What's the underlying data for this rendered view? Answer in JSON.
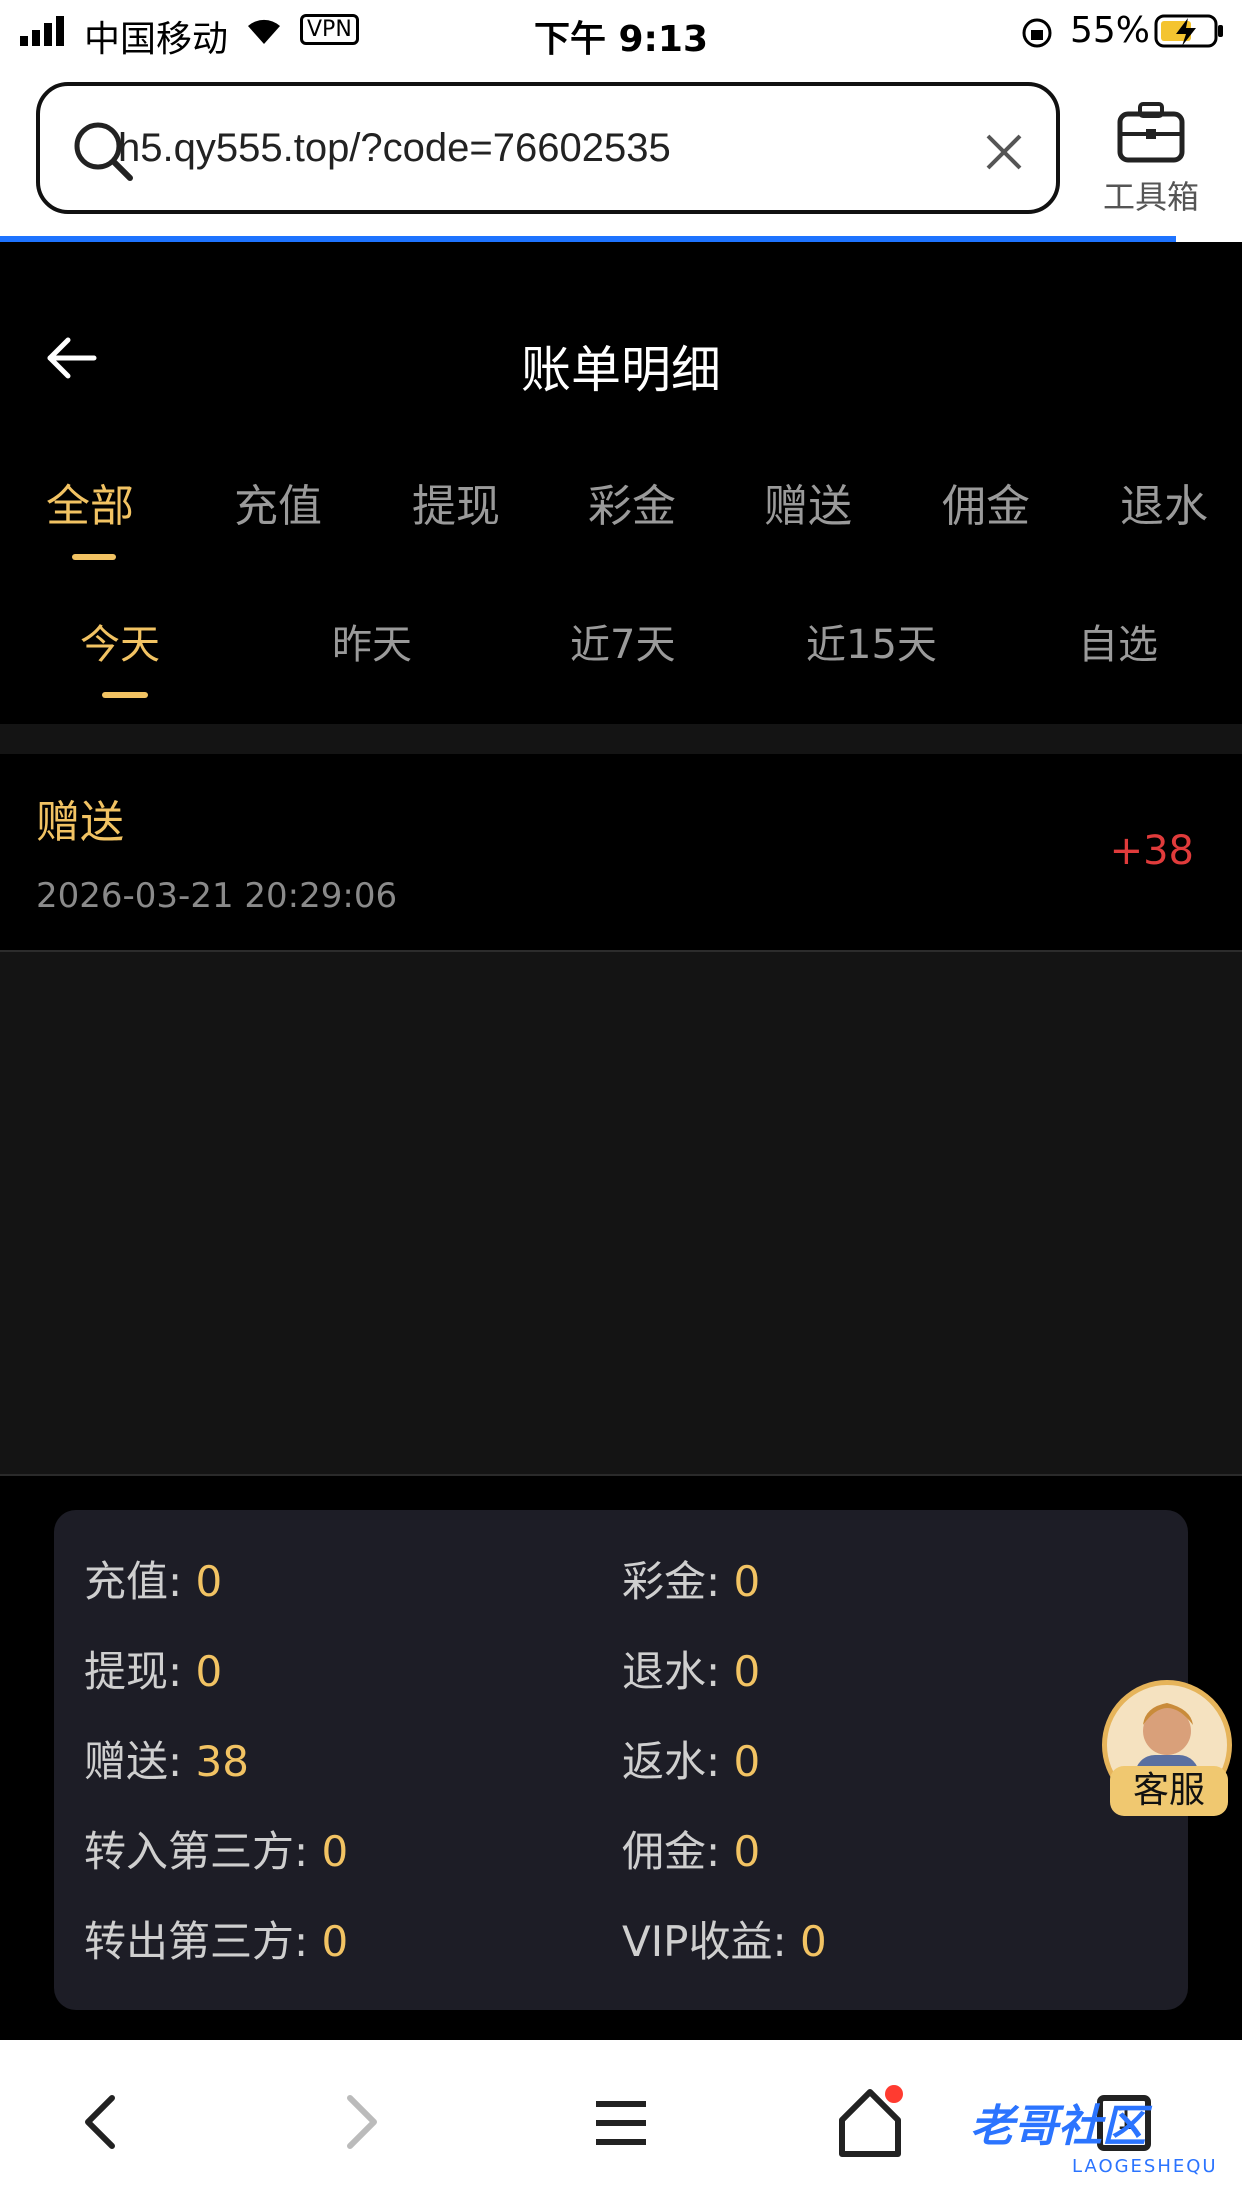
{
  "status_bar": {
    "carrier": "中国移动",
    "vpn": "VPN",
    "time": "下午 9:13",
    "battery": "55%"
  },
  "browser": {
    "url": "h5.qy555.top/?code=76602535",
    "toolbox_label": "工具箱"
  },
  "header": {
    "title": "账单明细"
  },
  "type_tabs": [
    "全部",
    "充值",
    "提现",
    "彩金",
    "赠送",
    "佣金",
    "退水"
  ],
  "type_tabs_active": "全部",
  "date_tabs": [
    "今天",
    "昨天",
    "近7天",
    "近15天",
    "自选"
  ],
  "date_tabs_active": "今天",
  "records": [
    {
      "type": "赠送",
      "datetime": "2026-03-21 20:29:06",
      "amount": "+38"
    }
  ],
  "summary": {
    "left": [
      {
        "label": "充值: ",
        "value": "0"
      },
      {
        "label": "提现: ",
        "value": "0"
      },
      {
        "label": "赠送: ",
        "value": "38"
      },
      {
        "label": "转入第三方: ",
        "value": "0"
      },
      {
        "label": "转出第三方: ",
        "value": "0"
      }
    ],
    "right": [
      {
        "label": "彩金: ",
        "value": "0"
      },
      {
        "label": "退水: ",
        "value": "0"
      },
      {
        "label": "返水: ",
        "value": "0"
      },
      {
        "label": "佣金: ",
        "value": "0"
      },
      {
        "label": "VIP收益: ",
        "value": "0"
      }
    ]
  },
  "service_label": "客服",
  "watermark": {
    "title": "老哥社区",
    "subtitle": "LAOGESHEQU"
  },
  "nav_tab_count": "1",
  "colors": {
    "accent": "#f2c363",
    "amount_positive": "#e03b3b",
    "progress": "#1e73ff"
  }
}
